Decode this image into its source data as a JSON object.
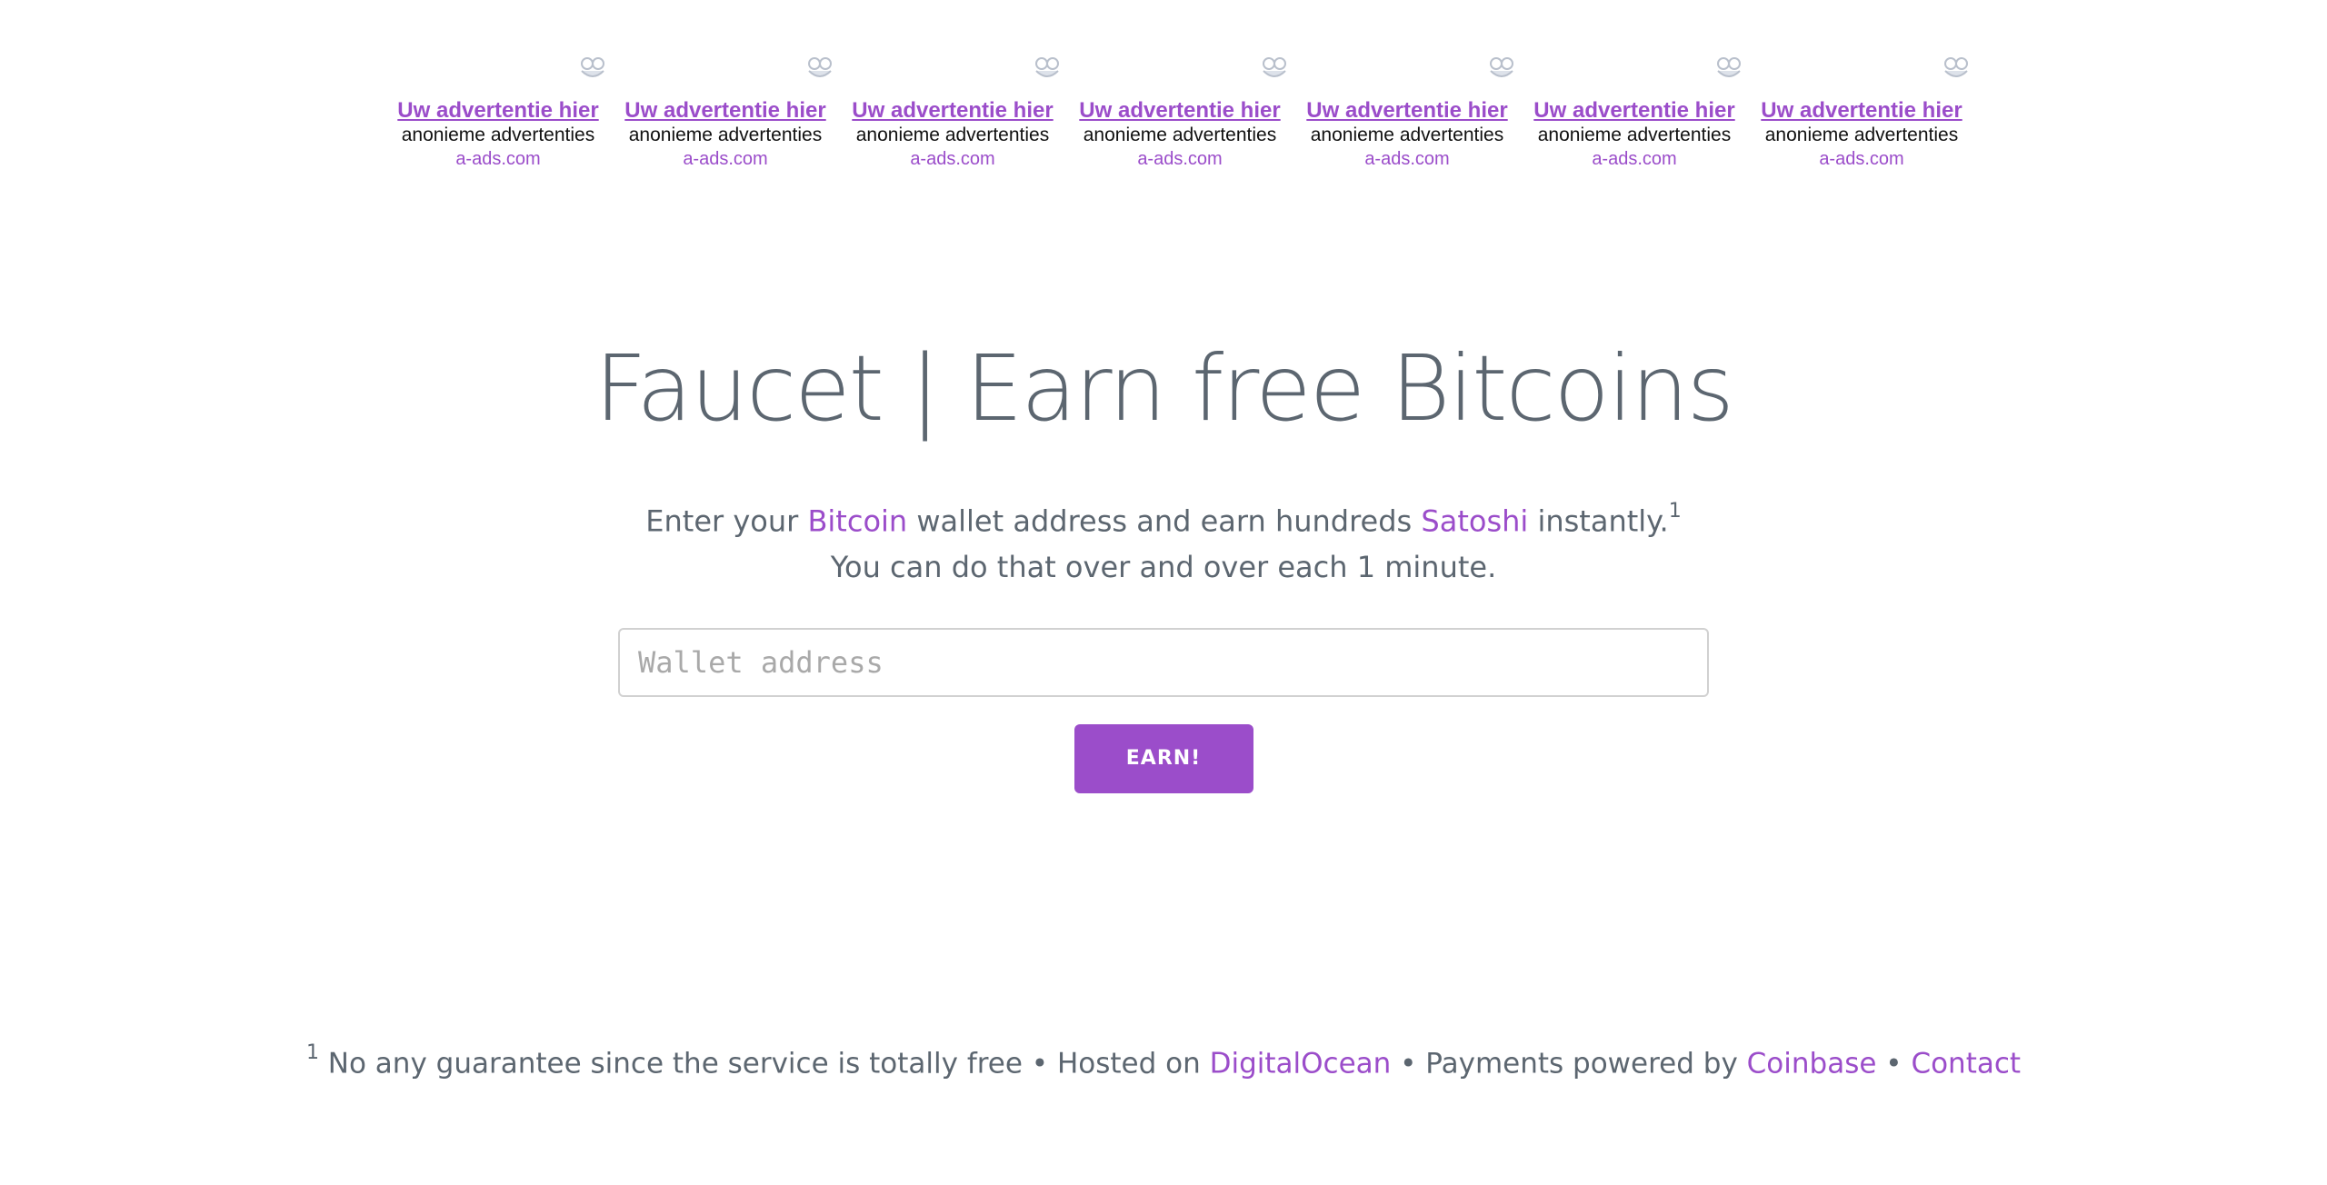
{
  "colors": {
    "accent": "#9b4dca",
    "text": "#5c6670",
    "ad_description": "#111111"
  },
  "ads": [
    {
      "title": "Uw advertentie hier",
      "description": "anonieme advertenties",
      "domain": "a-ads.com",
      "icon": "a-ads-logo-icon"
    },
    {
      "title": "Uw advertentie hier",
      "description": "anonieme advertenties",
      "domain": "a-ads.com",
      "icon": "a-ads-logo-icon"
    },
    {
      "title": "Uw advertentie hier",
      "description": "anonieme advertenties",
      "domain": "a-ads.com",
      "icon": "a-ads-logo-icon"
    },
    {
      "title": "Uw advertentie hier",
      "description": "anonieme advertenties",
      "domain": "a-ads.com",
      "icon": "a-ads-logo-icon"
    },
    {
      "title": "Uw advertentie hier",
      "description": "anonieme advertenties",
      "domain": "a-ads.com",
      "icon": "a-ads-logo-icon"
    },
    {
      "title": "Uw advertentie hier",
      "description": "anonieme advertenties",
      "domain": "a-ads.com",
      "icon": "a-ads-logo-icon"
    },
    {
      "title": "Uw advertentie hier",
      "description": "anonieme advertenties",
      "domain": "a-ads.com",
      "icon": "a-ads-logo-icon"
    }
  ],
  "hero": {
    "title": "Faucet | Earn free Bitcoins",
    "lead_line1_before": "Enter your ",
    "lead_line1_link1": "Bitcoin",
    "lead_line1_middle": " wallet address and earn hundreds ",
    "lead_line1_link2": "Satoshi",
    "lead_line1_after": " instantly.",
    "lead_line1_footnote": "1",
    "lead_line2": "You can do that over and over each 1 minute."
  },
  "form": {
    "wallet_placeholder": "Wallet address",
    "wallet_value": "",
    "earn_label": "EARN!"
  },
  "footer": {
    "footnote_mark": "1",
    "text1": " No any guarantee since the service is totally free • Hosted on ",
    "link_hosting": "DigitalOcean",
    "text2": " • Payments powered by ",
    "link_payments": "Coinbase",
    "text3": " • ",
    "link_contact": "Contact"
  }
}
